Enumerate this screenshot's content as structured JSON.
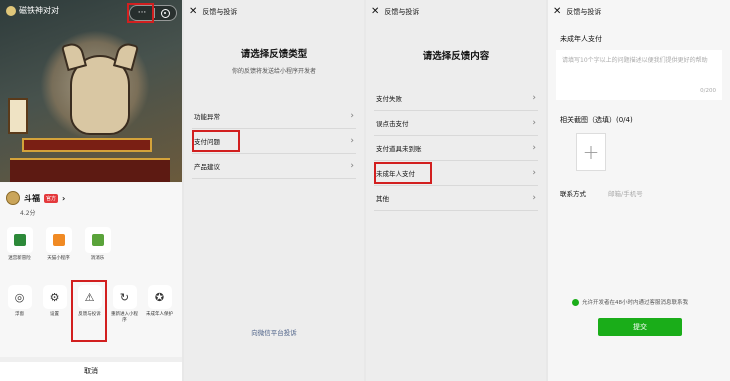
{
  "colors": {
    "accent_green": "#1aad19",
    "highlight_red": "#d21f1f",
    "link_blue": "#4a5f86"
  },
  "panel1": {
    "app_name": "磁铁神对对",
    "capsule": {
      "more": "···"
    },
    "sheet": {
      "name": "斗福",
      "tag": "官方",
      "rating": "4.2分",
      "apps": [
        {
          "label": "迷宫新冒险",
          "icon": "app-maze-icon",
          "color": "#2d8a3a"
        },
        {
          "label": "天猫小程序",
          "icon": "app-tmall-icon",
          "color": "#f08a24"
        },
        {
          "label": "消消乐",
          "icon": "app-match-icon",
          "color": "#5aa33a"
        }
      ],
      "actions": [
        {
          "label": "浮窗",
          "icon": "floating-window-icon",
          "glyph": "◎"
        },
        {
          "label": "设置",
          "icon": "settings-icon",
          "glyph": "⚙"
        },
        {
          "label": "反馈与投诉",
          "icon": "warning-icon",
          "glyph": "⚠"
        },
        {
          "label": "重新进入小程序",
          "icon": "restart-icon",
          "glyph": "↻"
        },
        {
          "label": "未成年人保护",
          "icon": "minor-protection-icon",
          "glyph": "✪"
        }
      ],
      "cancel": "取消"
    }
  },
  "panel2": {
    "nav_title": "反馈与投诉",
    "heading": "请选择反馈类型",
    "subheading": "你的反馈将发送给小程序开发者",
    "items": [
      "功能异常",
      "支付问题",
      "产品建议"
    ],
    "bottom_link": "向微信平台投诉"
  },
  "panel3": {
    "nav_title": "反馈与投诉",
    "heading": "请选择反馈内容",
    "items": [
      "支付失败",
      "误点击支付",
      "支付道具未到账",
      "未成年人支付",
      "其他"
    ]
  },
  "panel4": {
    "nav_title": "反馈与投诉",
    "field_title": "未成年人支付",
    "textarea_placeholder": "请填写10个字以上的问题描述以便我们提供更好的帮助",
    "counter": "0/200",
    "related_label": "相关截图（选填）(0/4)",
    "upload_plus": "+",
    "contact_label": "联系方式",
    "contact_placeholder": "邮箱/手机号",
    "agree_text": "允许开发者在48小时内通过客服消息联系我",
    "submit_label": "提交"
  }
}
